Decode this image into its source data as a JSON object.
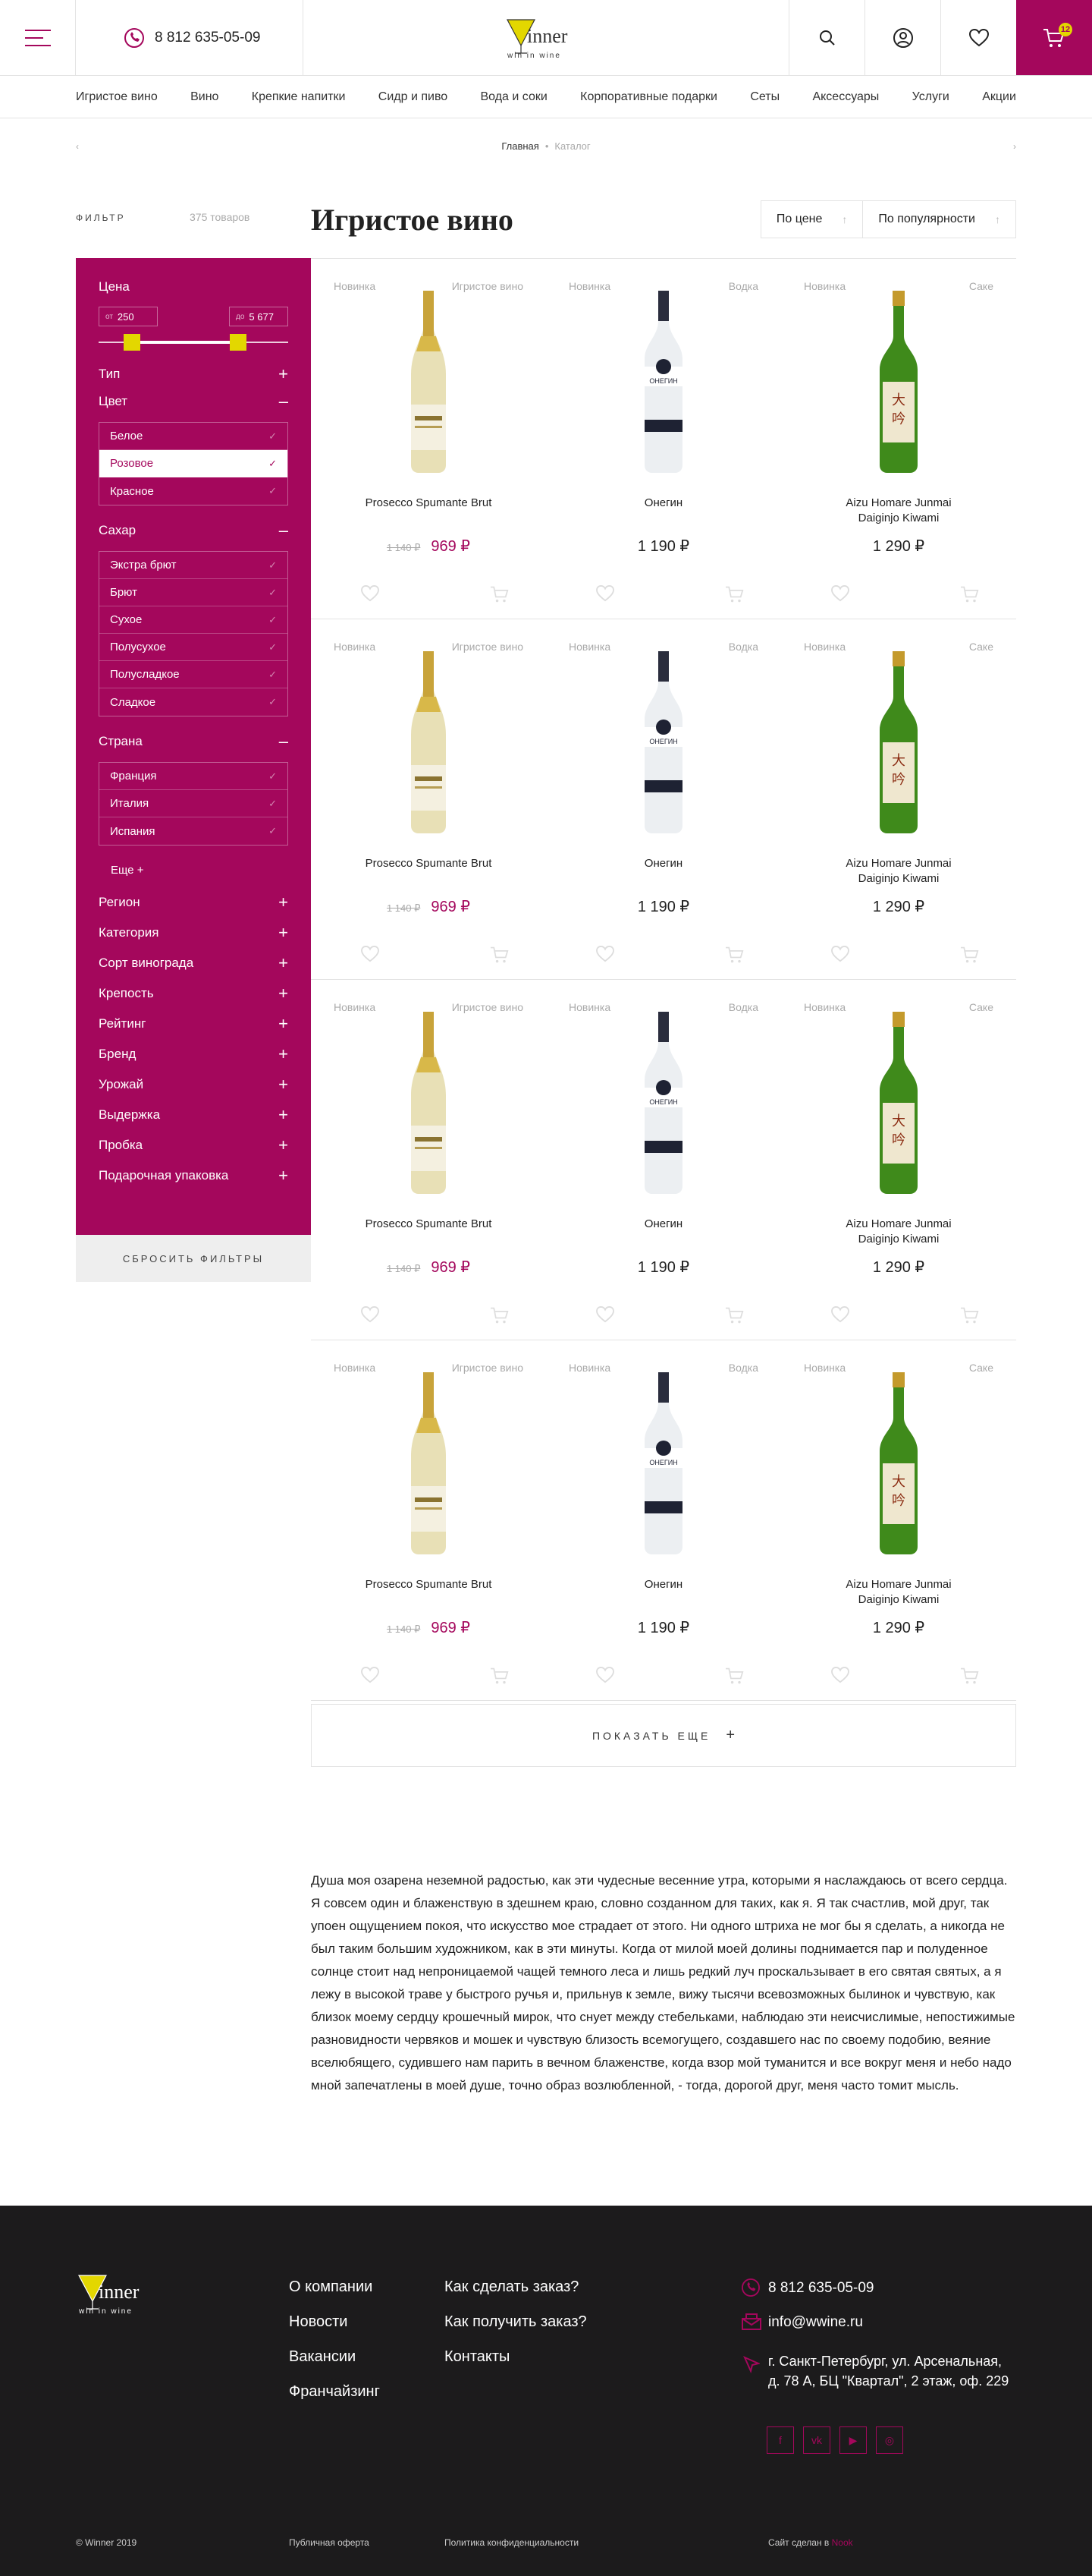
{
  "header": {
    "phone": "8 812 635-05-09",
    "logo_main": "Winner",
    "logo_sub": "win in wine",
    "cart_count": "12"
  },
  "nav": [
    "Игристое вино",
    "Вино",
    "Крепкие напитки",
    "Сидр и пиво",
    "Вода и соки",
    "Корпоративные подарки",
    "Сеты",
    "Аксессуары",
    "Услуги",
    "Акции"
  ],
  "breadcrumbs": {
    "home": "Главная",
    "current": "Каталог"
  },
  "page": {
    "filter_label": "ФИЛЬТР",
    "count_label": "375 товаров",
    "title": "Игристое вино",
    "sort_price": "По цене",
    "sort_popular": "По популярности"
  },
  "filter": {
    "price_label": "Цена",
    "from_prefix": "от",
    "from_value": "250",
    "to_prefix": "до",
    "to_value": "5 677",
    "type_label": "Тип",
    "color_label": "Цвет",
    "colors": [
      "Белое",
      "Розовое",
      "Красное"
    ],
    "sugar_label": "Сахар",
    "sugars": [
      "Экстра брют",
      "Брют",
      "Сухое",
      "Полусухое",
      "Полусладкое",
      "Сладкое"
    ],
    "country_label": "Страна",
    "countries": [
      "Франция",
      "Италия",
      "Испания"
    ],
    "more_label": "Еще",
    "sections": [
      "Регион",
      "Категория",
      "Сорт винограда",
      "Крепость",
      "Рейтинг",
      "Бренд",
      "Урожай",
      "Выдержка",
      "Пробка",
      "Подарочная упаковка"
    ],
    "reset_label": "СБРОСИТЬ ФИЛЬТРЫ"
  },
  "products": [
    {
      "badge": "Новинка",
      "category": "Игристое вино",
      "name": "Prosecco Spumante Brut",
      "old_price": "1 140 ₽",
      "price": "969 ₽"
    },
    {
      "badge": "Новинка",
      "category": "Водка",
      "name": "Онегин",
      "old_price": "",
      "price": "1 190 ₽"
    },
    {
      "badge": "Новинка",
      "category": "Саке",
      "name": "Aizu Homare Junmai Daiginjo Kiwami",
      "old_price": "",
      "price": "1 290 ₽"
    }
  ],
  "show_more": "ПОКАЗАТЬ ЕЩЕ",
  "seo_text": "Душа моя озарена неземной радостью, как эти чудесные весенние утра, которыми я наслаждаюсь от всего сердца. Я совсем один и блаженствую в здешнем краю, словно созданном для таких, как я. Я так счастлив, мой друг, так упоен ощущением покоя, что искусство мое страдает от этого. Ни одного штриха не мог бы я сделать, а никогда не был таким большим художником, как в эти минуты. Когда от милой моей долины поднимается пар и полуденное солнце стоит над непроницаемой чащей темного леса и лишь редкий луч проскальзывает в его святая святых, а я лежу в высокой траве у быстрого ручья и, прильнув к земле, вижу тысячи всевозможных былинок и чувствую, как близок моему сердцу крошечный мирок, что снует между стебельками, наблюдаю эти неисчислимые, непостижимые разновидности червяков и мошек и чувствую близость всемогущего, создавшего нас по своему подобию, веяние вселюбящего, судившего нам парить в вечном блаженстве, когда взор мой туманится и все вокруг меня и небо надо мной запечатлены в моей душе, точно образ возлюбленной, - тогда, дорогой друг, меня часто томит мысль.",
  "footer": {
    "col1": [
      "О компании",
      "Новости",
      "Вакансии",
      "Франчайзинг"
    ],
    "col2": [
      "Как сделать заказ?",
      "Как получить заказ?",
      "Контакты"
    ],
    "phone": "8 812 635-05-09",
    "email": "info@wwine.ru",
    "address_line1": "г. Санкт-Петербург, ул. Арсенальная,",
    "address_line2": "д. 78 А, БЦ \"Квартал\", 2 этаж, оф. 229",
    "social": [
      "f",
      "vk",
      "yt",
      "ig"
    ],
    "copyright": "© Winner 2019",
    "offer": "Публичная оферта",
    "privacy": "Политика конфиденциальности",
    "made_by": "Сайт сделан в",
    "made_by_link": "Nook"
  },
  "colors": {
    "accent": "#a4075c",
    "yellow": "#e3d700",
    "footer_bg": "#1c1b1c"
  }
}
